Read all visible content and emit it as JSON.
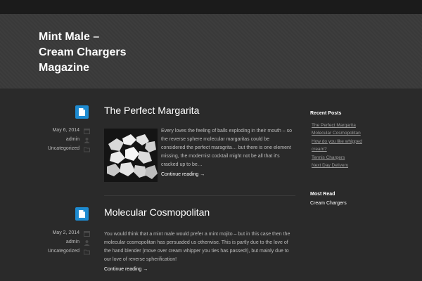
{
  "header": {
    "site_title": "Mint Male –\nCream Chargers\nMagazine"
  },
  "posts": [
    {
      "title": "The Perfect Margarita",
      "date": "May 6, 2014",
      "author": "admin",
      "category": "Uncategorized",
      "excerpt": "Every loves the feeling of balls exploding in their mouth – so the reverse sphere molecular margaritas could be considered the perfect maragrita… but there is one element missing, the modernist cocktail might not be all that it's cracked up to be…",
      "read_more": "Continue reading →",
      "format_icon": "document-icon"
    },
    {
      "title": "Molecular Cosmopolitan",
      "date": "May 2, 2014",
      "author": "admin",
      "category": "Uncategorized",
      "excerpt": "You would think that a mint male would prefer a mint mojito – but in this case then the molecular cosmopolitan has persuaded us otherwise. This is partly due to the love of the hand blender (move over cream whipper you ties has passed!), but mainly due to our love of reverse spherification!",
      "read_more": "Continue reading →",
      "format_icon": "document-icon"
    }
  ],
  "sidebar": {
    "recent_posts_title": "Recent Posts",
    "recent_posts": [
      "The Perfect Margarita",
      "Molecular Cosmopolitan",
      "How do you like whipped",
      "cream?",
      "Tennis Chargers",
      "Next Day Delivery"
    ],
    "most_read_title": "Most Read",
    "most_read": [
      "Cream Chargers"
    ]
  },
  "colors": {
    "background": "#282828",
    "header": "#3a3a3a",
    "accent": "#1e8bd1",
    "title": "#ffffff",
    "text": "#bdbdbd"
  }
}
